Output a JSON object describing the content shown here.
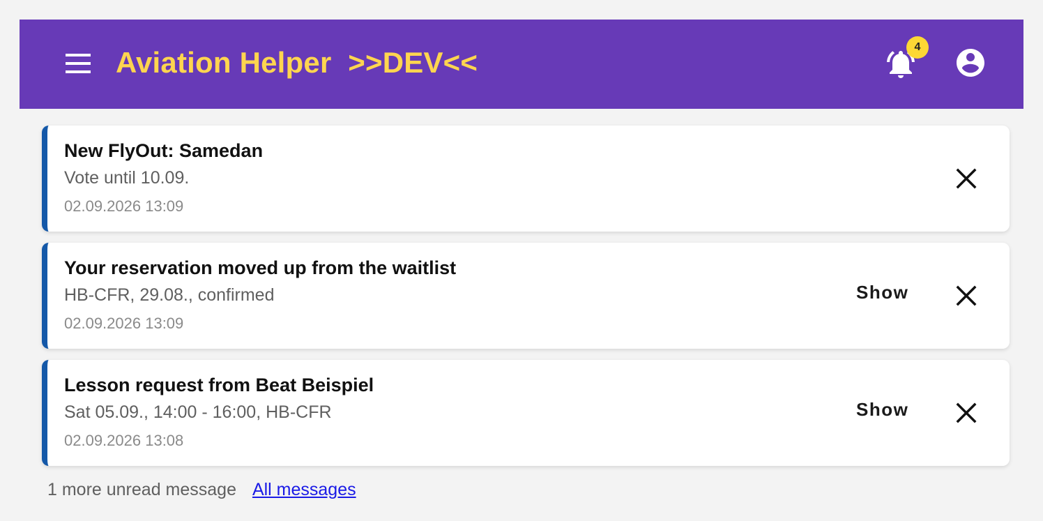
{
  "app": {
    "title": "Aviation Helper  >>DEV<<",
    "brand_color": "#673ab7",
    "title_color": "#ffd54f",
    "notification_count": "4",
    "icons": {
      "menu": "menu-icon",
      "notifications": "bell-icon",
      "account": "account-circle-icon"
    }
  },
  "notifications": [
    {
      "title": "New FlyOut: Samedan",
      "body": "Vote until 10.09.",
      "time": "02.09.2026 13:09",
      "has_show": false
    },
    {
      "title": "Your reservation moved up from the waitlist",
      "body": "HB-CFR, 29.08., confirmed",
      "time": "02.09.2026 13:09",
      "show_label": "Show",
      "has_show": true
    },
    {
      "title": "Lesson request from Beat Beispiel",
      "body": "Sat 05.09., 14:00 - 16:00, HB-CFR",
      "time": "02.09.2026 13:08",
      "show_label": "Show",
      "has_show": true
    }
  ],
  "footer": {
    "more_text": "1 more unread message",
    "all_link": "All messages"
  },
  "colors": {
    "card_accent": "#1458a8",
    "badge": "#fdd835",
    "link": "#1a1ae6"
  }
}
